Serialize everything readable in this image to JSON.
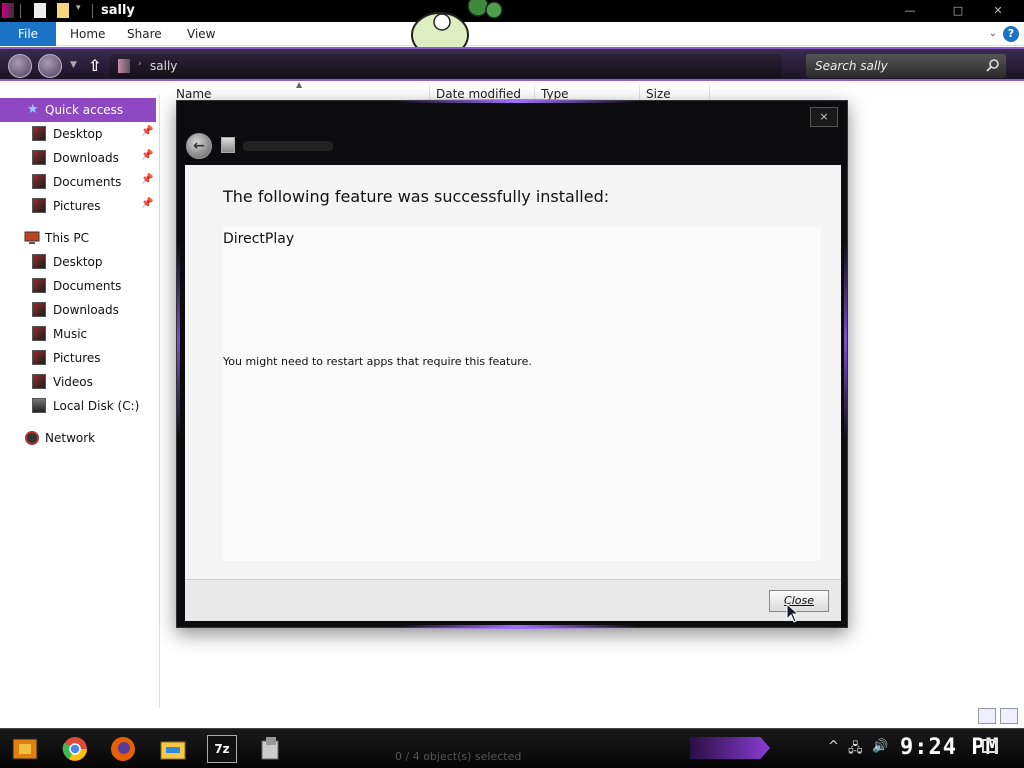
{
  "window": {
    "title": "sally"
  },
  "ribbon": {
    "tabs": [
      "File",
      "Home",
      "Share",
      "View"
    ],
    "help": "?"
  },
  "address": {
    "path": "sally",
    "search_placeholder": "Search sally"
  },
  "sidebar": {
    "quick_access": "Quick access",
    "quick_items": [
      "Desktop",
      "Downloads",
      "Documents",
      "Pictures"
    ],
    "this_pc": "This PC",
    "pc_items": [
      "Desktop",
      "Documents",
      "Downloads",
      "Music",
      "Pictures",
      "Videos",
      "Local Disk (C:)"
    ],
    "network": "Network"
  },
  "columns": [
    "Name",
    "Date modified",
    "Type",
    "Size"
  ],
  "dialog": {
    "close_x": "×",
    "heading": "The following feature was successfully installed:",
    "feature": "DirectPlay",
    "note": "You might need to restart apps that require this feature.",
    "close_button": "Close"
  },
  "taskbar": {
    "status": "0 / 4 object(s) selected",
    "clock": "9:24 PM",
    "apps": [
      "start-icon",
      "chrome-icon",
      "firefox-icon",
      "file-explorer-icon",
      "7zip-icon",
      "app-icon"
    ],
    "sevenzip_label": "7z"
  },
  "colors": {
    "accent_purple": "#8e49c2",
    "file_tab_blue": "#1a73c6"
  }
}
